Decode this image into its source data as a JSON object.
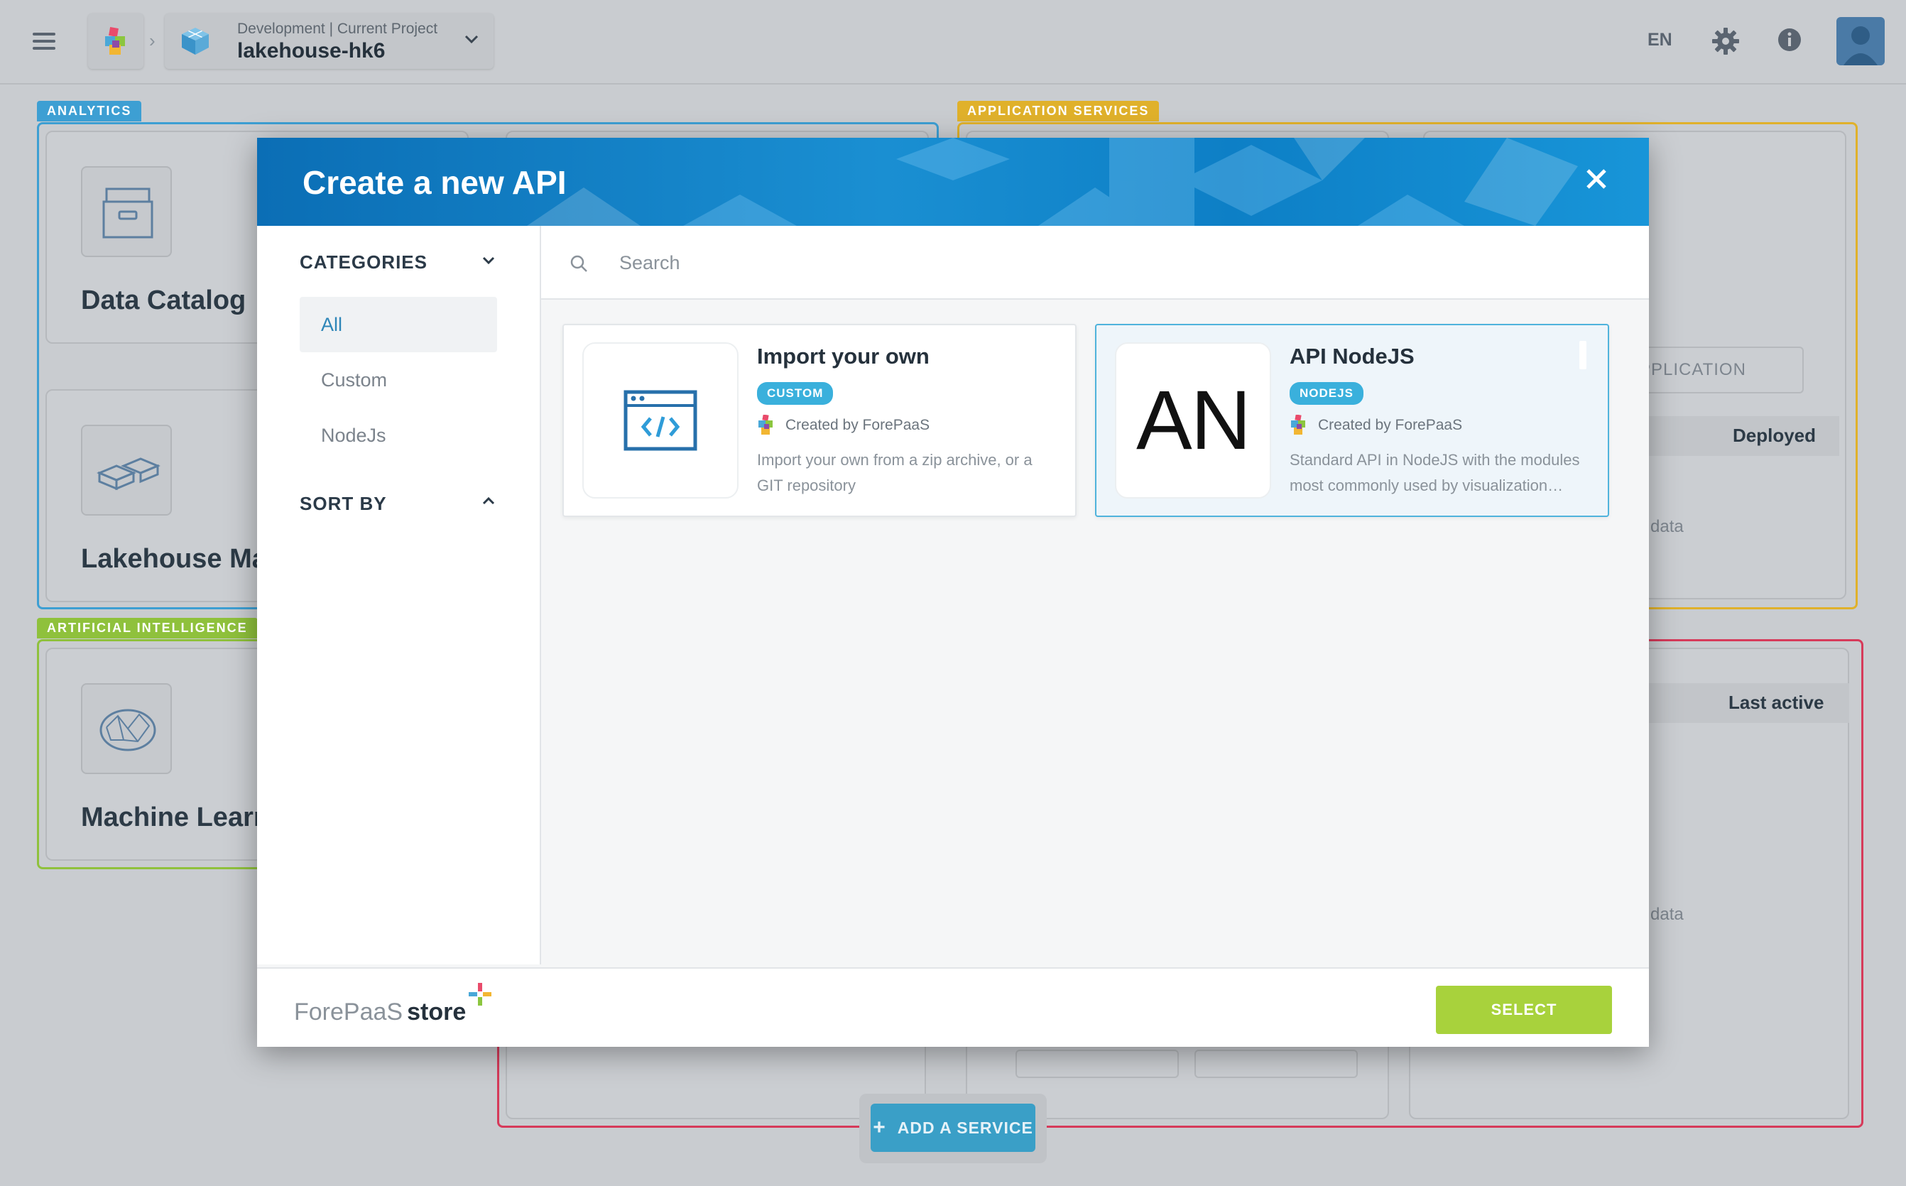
{
  "topbar": {
    "project_context": "Development | Current Project",
    "project_name": "lakehouse-hk6",
    "language": "EN"
  },
  "dashboard": {
    "sections": {
      "analytics": "ANALYTICS",
      "application_services": "APPLICATION SERVICES",
      "artificial_intelligence": "ARTIFICIAL INTELLIGENCE"
    },
    "cards": {
      "data_catalog": "Data Catalog",
      "lakehouse_manager": "Lakehouse Mar",
      "machine_learning": "Machine Learni"
    },
    "fragments": {
      "application_button": "PPLICATION",
      "deployed": "Deployed",
      "data_1": "data",
      "last_active": "Last active",
      "data_2": "data"
    },
    "add_service": "ADD A SERVICE"
  },
  "modal": {
    "title": "Create a new API",
    "categories_heading": "CATEGORIES",
    "categories": [
      "All",
      "Custom",
      "NodeJs"
    ],
    "sort_heading": "SORT BY",
    "search_placeholder": "Search",
    "items": [
      {
        "title": "Import your own",
        "badge": "CUSTOM",
        "creator": "Created by ForePaaS",
        "desc_line1": "Import your own from a zip archive, or a",
        "desc_line2": "GIT repository",
        "icon": "code-window-icon"
      },
      {
        "title": "API NodeJS",
        "badge": "NODEJS",
        "abbr": "AN",
        "creator": "Created by ForePaaS",
        "desc_line1": "Standard API in NodeJS with the modules",
        "desc_line2": "most commonly used by visualization…"
      }
    ],
    "brand": "ForePaaS",
    "brand_store": "store",
    "select": "SELECT"
  },
  "colors": {
    "accent": "#3ab0dc",
    "select": "#a8d23c",
    "analytics": "#3d9fd3",
    "app_services": "#e0b12b",
    "ai": "#8fc13c",
    "red_section": "#d63a5a"
  }
}
